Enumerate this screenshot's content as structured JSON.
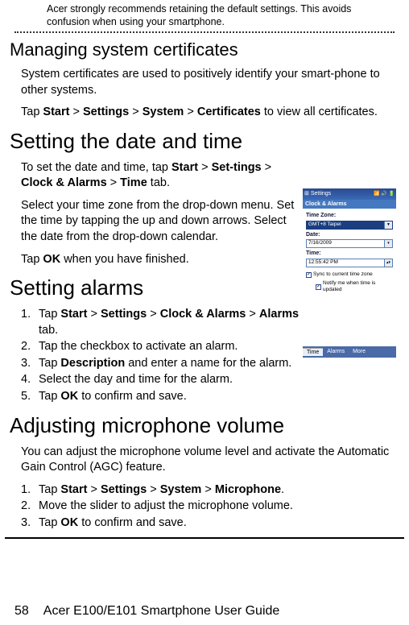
{
  "note": "Acer strongly recommends retaining the default settings. This avoids confusion when using your smartphone.",
  "h2_certs": "Managing system certificates",
  "certs_p1": "System certificates are used to positively identify your smart-phone to other systems.",
  "certs_p2": {
    "pre": "Tap ",
    "b1": "Start",
    "gt": " > ",
    "b2": "Settings",
    "b3": "System",
    "b4": "Certificates",
    "post": " to view all certificates."
  },
  "h1_date": "Setting the date and time",
  "date_p1": {
    "pre": "To set the date and time, tap ",
    "b1": "Start",
    "gt": " > ",
    "b2": "Set-tings",
    "b3": "Clock & Alarms",
    "b4": "Time",
    "post": " tab."
  },
  "date_p2": "Select your time zone from the drop-down menu. Set the time by tapping the up and down arrows. Select the date from the drop-down calendar.",
  "date_p3": {
    "pre": "Tap ",
    "b1": "OK",
    "post": " when you have finished."
  },
  "h1_alarms": "Setting alarms",
  "alarms": {
    "li1": {
      "pre": "Tap ",
      "b1": "Start",
      "gt": " > ",
      "b2": "Settings",
      "b3": "Clock & Alarms",
      "b4": "Alarms",
      "post": " tab."
    },
    "li2": "Tap the checkbox to activate an alarm.",
    "li3": {
      "pre": "Tap ",
      "b1": "Description",
      "post": " and enter a name for the alarm."
    },
    "li4": "Select the day and time for the alarm.",
    "li5": {
      "pre": "Tap ",
      "b1": "OK",
      "post": " to confirm and save."
    }
  },
  "h1_mic": "Adjusting microphone volume",
  "mic_p1": "You can adjust the microphone volume level and activate the Automatic Gain Control (AGC) feature.",
  "mic": {
    "li1": {
      "pre": "Tap ",
      "b1": "Start",
      "gt": " > ",
      "b2": "Settings",
      "b3": "System",
      "b4": "Microphone",
      "post": "."
    },
    "li2": "Move the slider to adjust the microphone volume.",
    "li3": {
      "pre": "Tap ",
      "b1": "OK",
      "post": " to confirm and save."
    }
  },
  "screenshot": {
    "title": "Settings",
    "section": "Clock & Alarms",
    "tz_label": "Time Zone:",
    "tz_value": "GMT+8 Taipei",
    "date_label": "Date:",
    "date_value": "7/16/2009",
    "time_label": "Time:",
    "time_value": "12:55:42 PM",
    "chk1": "Sync to current time zone",
    "chk2": "Notify me when time is updated",
    "tab1": "Time",
    "tab2": "Alarms",
    "tab3": "More"
  },
  "footer": {
    "page": "58",
    "guide": "Acer E100/E101 Smartphone User Guide"
  }
}
